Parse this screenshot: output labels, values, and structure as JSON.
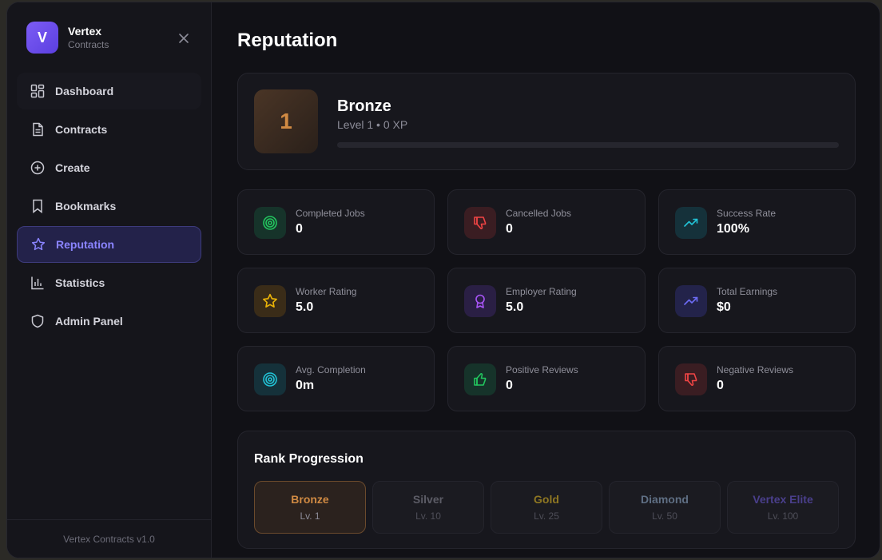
{
  "brand": {
    "logo_letter": "V",
    "name": "Vertex",
    "subtitle": "Contracts"
  },
  "nav": [
    {
      "label": "Dashboard",
      "icon": "dashboard-icon"
    },
    {
      "label": "Contracts",
      "icon": "document-icon"
    },
    {
      "label": "Create",
      "icon": "plus-circle-icon"
    },
    {
      "label": "Bookmarks",
      "icon": "bookmark-icon"
    },
    {
      "label": "Reputation",
      "icon": "star-icon",
      "active": true
    },
    {
      "label": "Statistics",
      "icon": "bar-chart-icon"
    },
    {
      "label": "Admin Panel",
      "icon": "shield-icon"
    }
  ],
  "footer": {
    "version": "Vertex Contracts v1.0"
  },
  "page": {
    "title": "Reputation"
  },
  "rank": {
    "level_number": "1",
    "name": "Bronze",
    "subtitle": "Level 1 • 0 XP",
    "xp_progress": 0
  },
  "stats": [
    {
      "label": "Completed Jobs",
      "value": "0",
      "icon": "target-icon",
      "color": "#22c55e",
      "bg": "#16332a"
    },
    {
      "label": "Cancelled Jobs",
      "value": "0",
      "icon": "thumbs-down-icon",
      "color": "#ef4444",
      "bg": "#3a1d22"
    },
    {
      "label": "Success Rate",
      "value": "100%",
      "icon": "trending-up-icon",
      "color": "#22c3d6",
      "bg": "#15313a"
    },
    {
      "label": "Worker Rating",
      "value": "5.0",
      "icon": "star-icon",
      "color": "#eab308",
      "bg": "#3a2c18"
    },
    {
      "label": "Employer Rating",
      "value": "5.0",
      "icon": "award-icon",
      "color": "#a855f7",
      "bg": "#2a1f44"
    },
    {
      "label": "Total Earnings",
      "value": "$0",
      "icon": "trending-up-icon",
      "color": "#6d6cf5",
      "bg": "#23234a"
    },
    {
      "label": "Avg. Completion",
      "value": "0m",
      "icon": "target-icon",
      "color": "#22c3d6",
      "bg": "#15313a"
    },
    {
      "label": "Positive Reviews",
      "value": "0",
      "icon": "thumbs-up-icon",
      "color": "#22c55e",
      "bg": "#16332a"
    },
    {
      "label": "Negative Reviews",
      "value": "0",
      "icon": "thumbs-down-icon",
      "color": "#ef4444",
      "bg": "#3a1d22"
    }
  ],
  "progression": {
    "title": "Rank Progression",
    "tiers": [
      {
        "name": "Bronze",
        "level": "Lv. 1",
        "color": "#d08a43",
        "current": true
      },
      {
        "name": "Silver",
        "level": "Lv. 10",
        "color": "#5c5c66"
      },
      {
        "name": "Gold",
        "level": "Lv. 25",
        "color": "#8f7722"
      },
      {
        "name": "Diamond",
        "level": "Lv. 50",
        "color": "#5f6f84"
      },
      {
        "name": "Vertex Elite",
        "level": "Lv. 100",
        "color": "#4a3f8c"
      }
    ]
  }
}
